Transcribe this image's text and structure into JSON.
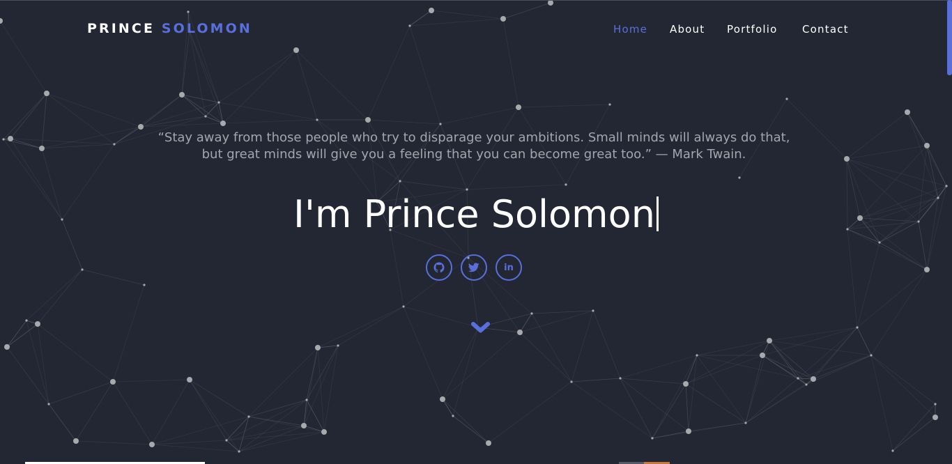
{
  "brand": {
    "first": "PRINCE",
    "last": "SOLOMON"
  },
  "nav": {
    "items": [
      {
        "label": "Home",
        "active": true
      },
      {
        "label": "About",
        "active": false
      },
      {
        "label": "Portfolio",
        "active": false
      },
      {
        "label": "Contact",
        "active": false
      }
    ]
  },
  "hero": {
    "quote": "“Stay away from those people who try to disparage your ambitions. Small minds will always do that, but great minds will give you a feeling that you can become great too.” — Mark Twain.",
    "title": "I'm Prince Solomon"
  },
  "socials": [
    {
      "name": "github",
      "icon": "github-icon"
    },
    {
      "name": "twitter",
      "icon": "twitter-icon"
    },
    {
      "name": "linkedin",
      "icon": "linkedin-icon",
      "text": "in"
    }
  ],
  "scroll_down": {
    "icon": "chevron-down-icon"
  },
  "colors": {
    "background": "#222733",
    "accent": "#5a6fdc",
    "text": "#ffffff",
    "quote": "#a3a6ad",
    "network_node": "#a8a9ad",
    "network_line": "#5e626c"
  }
}
